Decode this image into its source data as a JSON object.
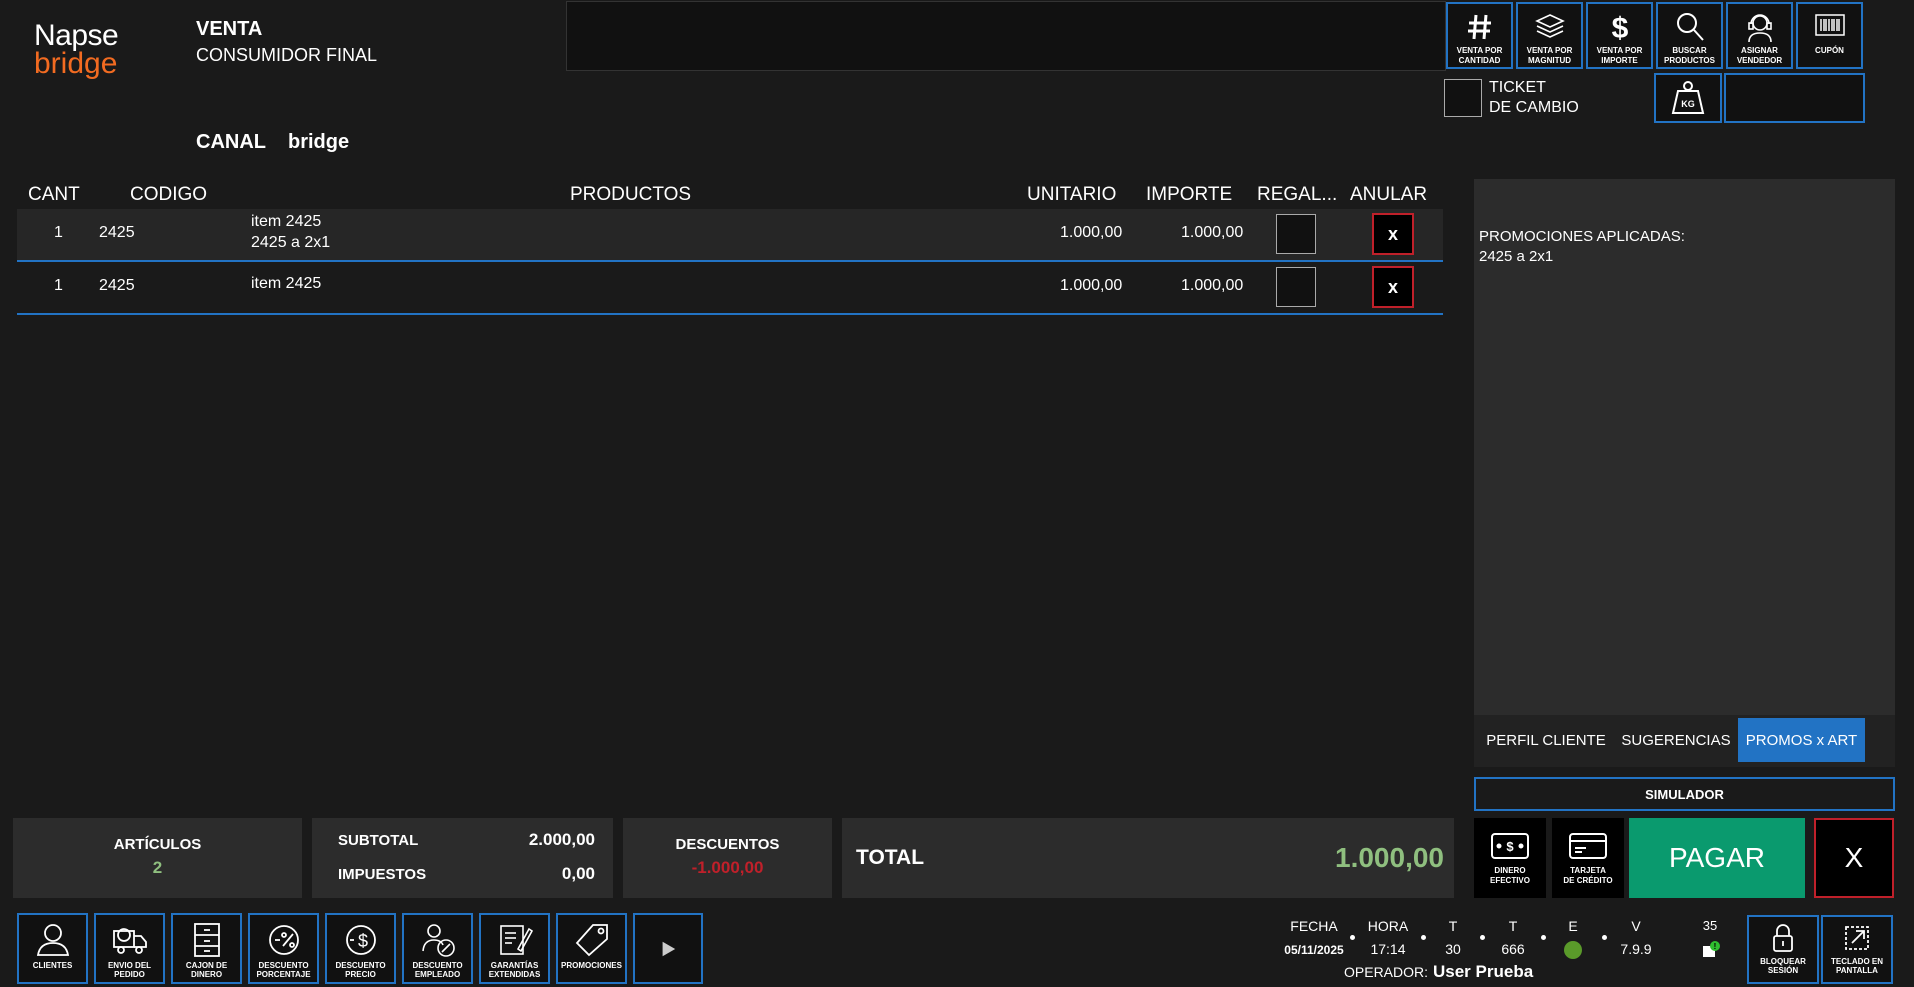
{
  "logo": {
    "line1": "Napse",
    "line2": "bridge"
  },
  "header": {
    "venta_title": "VENTA",
    "venta_sub": "CONSUMIDOR FINAL",
    "canal_label": "CANAL",
    "canal_value": "bridge"
  },
  "toolbar": [
    {
      "label": "VENTA POR CANTIDAD",
      "icon": "hash-icon"
    },
    {
      "label": "VENTA POR MAGNITUD",
      "icon": "layers-icon"
    },
    {
      "label": "VENTA POR IMPORTE",
      "icon": "dollar-icon"
    },
    {
      "label": "BUSCAR PRODUCTOS",
      "icon": "search-icon"
    },
    {
      "label": "ASIGNAR VENDEDOR",
      "icon": "headset-icon"
    },
    {
      "label": "CUPÓN",
      "icon": "barcode-icon"
    }
  ],
  "ticket_cambio": "TICKET\nDE CAMBIO",
  "kg_label": "KG",
  "table": {
    "headers": {
      "cant": "CANT",
      "codigo": "CODIGO",
      "productos": "PRODUCTOS",
      "unitario": "UNITARIO",
      "importe": "IMPORTE",
      "regalo": "REGAL...",
      "anular": "ANULAR"
    },
    "rows": [
      {
        "cant": "1",
        "codigo": "2425",
        "producto": "item 2425",
        "promo": "2425 a 2x1",
        "unitario": "1.000,00",
        "importe": "1.000,00",
        "anular": "x"
      },
      {
        "cant": "1",
        "codigo": "2425",
        "producto": "item 2425",
        "promo": "",
        "unitario": "1.000,00",
        "importe": "1.000,00",
        "anular": "x"
      }
    ]
  },
  "right_panel": {
    "promo_title": "PROMOCIONES APLICADAS:",
    "promo_item": "2425 a 2x1",
    "tabs": [
      "PERFIL CLIENTE",
      "SUGERENCIAS",
      "PROMOS x ART"
    ],
    "active_tab": "PROMOS x ART",
    "simulador": "SIMULADOR"
  },
  "totals": {
    "articulos_label": "ARTÍCULOS",
    "articulos_value": "2",
    "subtotal_label": "SUBTOTAL",
    "subtotal_value": "2.000,00",
    "impuestos_label": "IMPUESTOS",
    "impuestos_value": "0,00",
    "descuentos_label": "DESCUENTOS",
    "descuentos_value": "-1.000,00",
    "total_label": "TOTAL",
    "total_value": "1.000,00"
  },
  "payment": {
    "efectivo": "DINERO\nEFECTIVO",
    "tarjeta": "TARJETA\nDE CRÉDITO",
    "pagar": "PAGAR",
    "cancel": "X"
  },
  "bottom_toolbar": [
    {
      "label": "CLIENTES",
      "icon": "user-icon"
    },
    {
      "label": "ENVIO DEL\nPEDIDO",
      "icon": "truck-icon"
    },
    {
      "label": "CAJON DE\nDINERO",
      "icon": "drawer-icon"
    },
    {
      "label": "DESCUENTO\nPORCENTAJE",
      "icon": "percent-icon"
    },
    {
      "label": "DESCUENTO\nPRECIO",
      "icon": "price-icon"
    },
    {
      "label": "DESCUENTO\nEMPLEADO",
      "icon": "employee-icon"
    },
    {
      "label": "GARANTÍAS\nEXTENDIDAS",
      "icon": "pen-icon"
    },
    {
      "label": "PROMOCIONES",
      "icon": "tag-icon"
    }
  ],
  "status": {
    "fecha_label": "FECHA",
    "fecha_value": "05/11/2025",
    "hora_label": "HORA",
    "hora_value": "17:14",
    "t1_label": "T",
    "t1_value": "30",
    "t2_label": "T",
    "t2_value": "666",
    "e_label": "E",
    "v_label": "V",
    "v_value": "7.9.9",
    "count_value": "35",
    "operador_label": "OPERADOR:",
    "operador_value": "User Prueba"
  },
  "bottom_right": [
    {
      "label": "BLOQUEAR\nSESIÓN",
      "icon": "lock-icon"
    },
    {
      "label": "TECLADO EN\nPANTALLA",
      "icon": "keyboard-icon"
    }
  ],
  "colors": {
    "accent": "#2273c4",
    "brand": "#f26b21",
    "pay": "#0a9a6e",
    "danger": "#c0202a",
    "positive": "#8fbf7f"
  }
}
